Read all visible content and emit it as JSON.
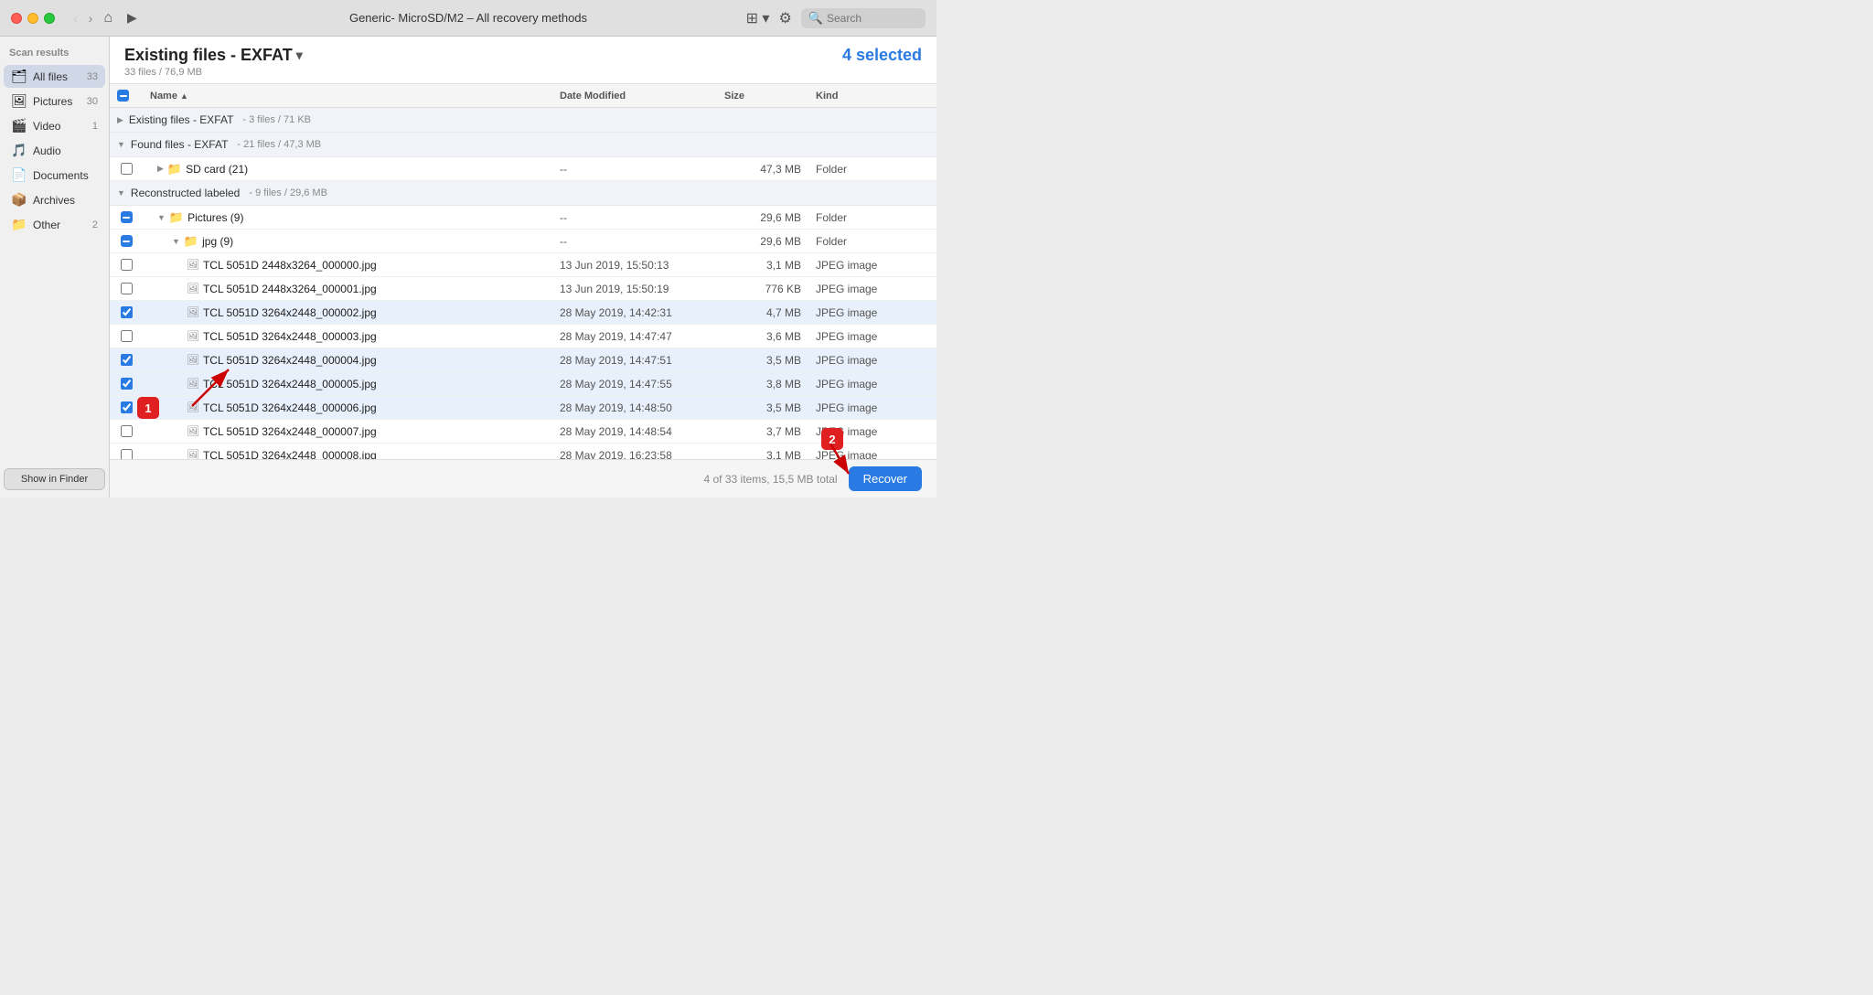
{
  "window": {
    "title": "Generic- MicroSD/M2 – All recovery methods",
    "search_placeholder": "Search"
  },
  "sidebar": {
    "header": "Scan results",
    "items": [
      {
        "id": "all-files",
        "label": "All files",
        "count": "33",
        "icon": "🗂",
        "active": true
      },
      {
        "id": "pictures",
        "label": "Pictures",
        "count": "30",
        "icon": "🖼",
        "active": false
      },
      {
        "id": "video",
        "label": "Video",
        "count": "1",
        "icon": "🎬",
        "active": false
      },
      {
        "id": "audio",
        "label": "Audio",
        "count": "",
        "icon": "🎵",
        "active": false
      },
      {
        "id": "documents",
        "label": "Documents",
        "count": "",
        "icon": "📄",
        "active": false
      },
      {
        "id": "archives",
        "label": "Archives",
        "count": "",
        "icon": "📦",
        "active": false
      },
      {
        "id": "other",
        "label": "Other",
        "count": "2",
        "icon": "📁",
        "active": false
      }
    ],
    "show_finder_label": "Show in Finder"
  },
  "content": {
    "title": "Existing files - EXFAT",
    "subtitle": "33 files / 76,9 MB",
    "selected_label": "4 selected",
    "columns": {
      "name": "Name",
      "date_modified": "Date Modified",
      "size": "Size",
      "kind": "Kind"
    },
    "sections": [
      {
        "id": "existing",
        "label": "Existing files - EXFAT",
        "info": "3 files / 71 KB",
        "collapsed": true,
        "indent": 0
      },
      {
        "id": "found",
        "label": "Found files - EXFAT",
        "info": "21 files / 47,3 MB",
        "collapsed": false,
        "indent": 0
      }
    ],
    "rows": [
      {
        "id": "sdcard",
        "name": "SD card (21)",
        "date": "--",
        "size": "47,3 MB",
        "kind": "Folder",
        "indent": 1,
        "type": "folder",
        "check": "none",
        "collapsed": true
      },
      {
        "id": "reconstructed",
        "name": "Reconstructed labeled",
        "info": "9 files / 29,6 MB",
        "section": true,
        "indent": 0
      },
      {
        "id": "pictures9",
        "name": "Pictures (9)",
        "date": "--",
        "size": "29,6 MB",
        "kind": "Folder",
        "indent": 1,
        "type": "folder",
        "check": "minus"
      },
      {
        "id": "jpg9",
        "name": "jpg (9)",
        "date": "--",
        "size": "29,6 MB",
        "kind": "Folder",
        "indent": 2,
        "type": "folder",
        "check": "minus"
      },
      {
        "id": "file0",
        "name": "TCL 5051D 2448x3264_000000.jpg",
        "date": "13 Jun 2019, 15:50:13",
        "size": "3,1 MB",
        "kind": "JPEG image",
        "indent": 3,
        "type": "file",
        "check": "unchecked"
      },
      {
        "id": "file1",
        "name": "TCL 5051D 2448x3264_000001.jpg",
        "date": "13 Jun 2019, 15:50:19",
        "size": "776 KB",
        "kind": "JPEG image",
        "indent": 3,
        "type": "file",
        "check": "unchecked"
      },
      {
        "id": "file2",
        "name": "TCL 5051D 3264x2448_000002.jpg",
        "date": "28 May 2019, 14:42:31",
        "size": "4,7 MB",
        "kind": "JPEG image",
        "indent": 3,
        "type": "file",
        "check": "checked"
      },
      {
        "id": "file3",
        "name": "TCL 5051D 3264x2448_000003.jpg",
        "date": "28 May 2019, 14:47:47",
        "size": "3,6 MB",
        "kind": "JPEG image",
        "indent": 3,
        "type": "file",
        "check": "unchecked"
      },
      {
        "id": "file4",
        "name": "TCL 5051D 3264x2448_000004.jpg",
        "date": "28 May 2019, 14:47:51",
        "size": "3,5 MB",
        "kind": "JPEG image",
        "indent": 3,
        "type": "file",
        "check": "checked"
      },
      {
        "id": "file5",
        "name": "TCL 5051D 3264x2448_000005.jpg",
        "date": "28 May 2019, 14:47:55",
        "size": "3,8 MB",
        "kind": "JPEG image",
        "indent": 3,
        "type": "file",
        "check": "checked"
      },
      {
        "id": "file6",
        "name": "TCL 5051D 3264x2448_000006.jpg",
        "date": "28 May 2019, 14:48:50",
        "size": "3,5 MB",
        "kind": "JPEG image",
        "indent": 3,
        "type": "file",
        "check": "checked"
      },
      {
        "id": "file7",
        "name": "TCL 5051D 3264x2448_000007.jpg",
        "date": "28 May 2019, 14:48:54",
        "size": "3,7 MB",
        "kind": "JPEG image",
        "indent": 3,
        "type": "file",
        "check": "unchecked"
      },
      {
        "id": "file8",
        "name": "TCL 5051D 3264x2448_000008.jpg",
        "date": "28 May 2019, 16:23:58",
        "size": "3,1 MB",
        "kind": "JPEG image",
        "indent": 3,
        "type": "file",
        "check": "unchecked"
      }
    ],
    "footer": {
      "status": "4 of 33 items, 15,5 MB total",
      "recover_label": "Recover"
    }
  },
  "annotations": {
    "badge1": "1",
    "badge2": "2"
  }
}
